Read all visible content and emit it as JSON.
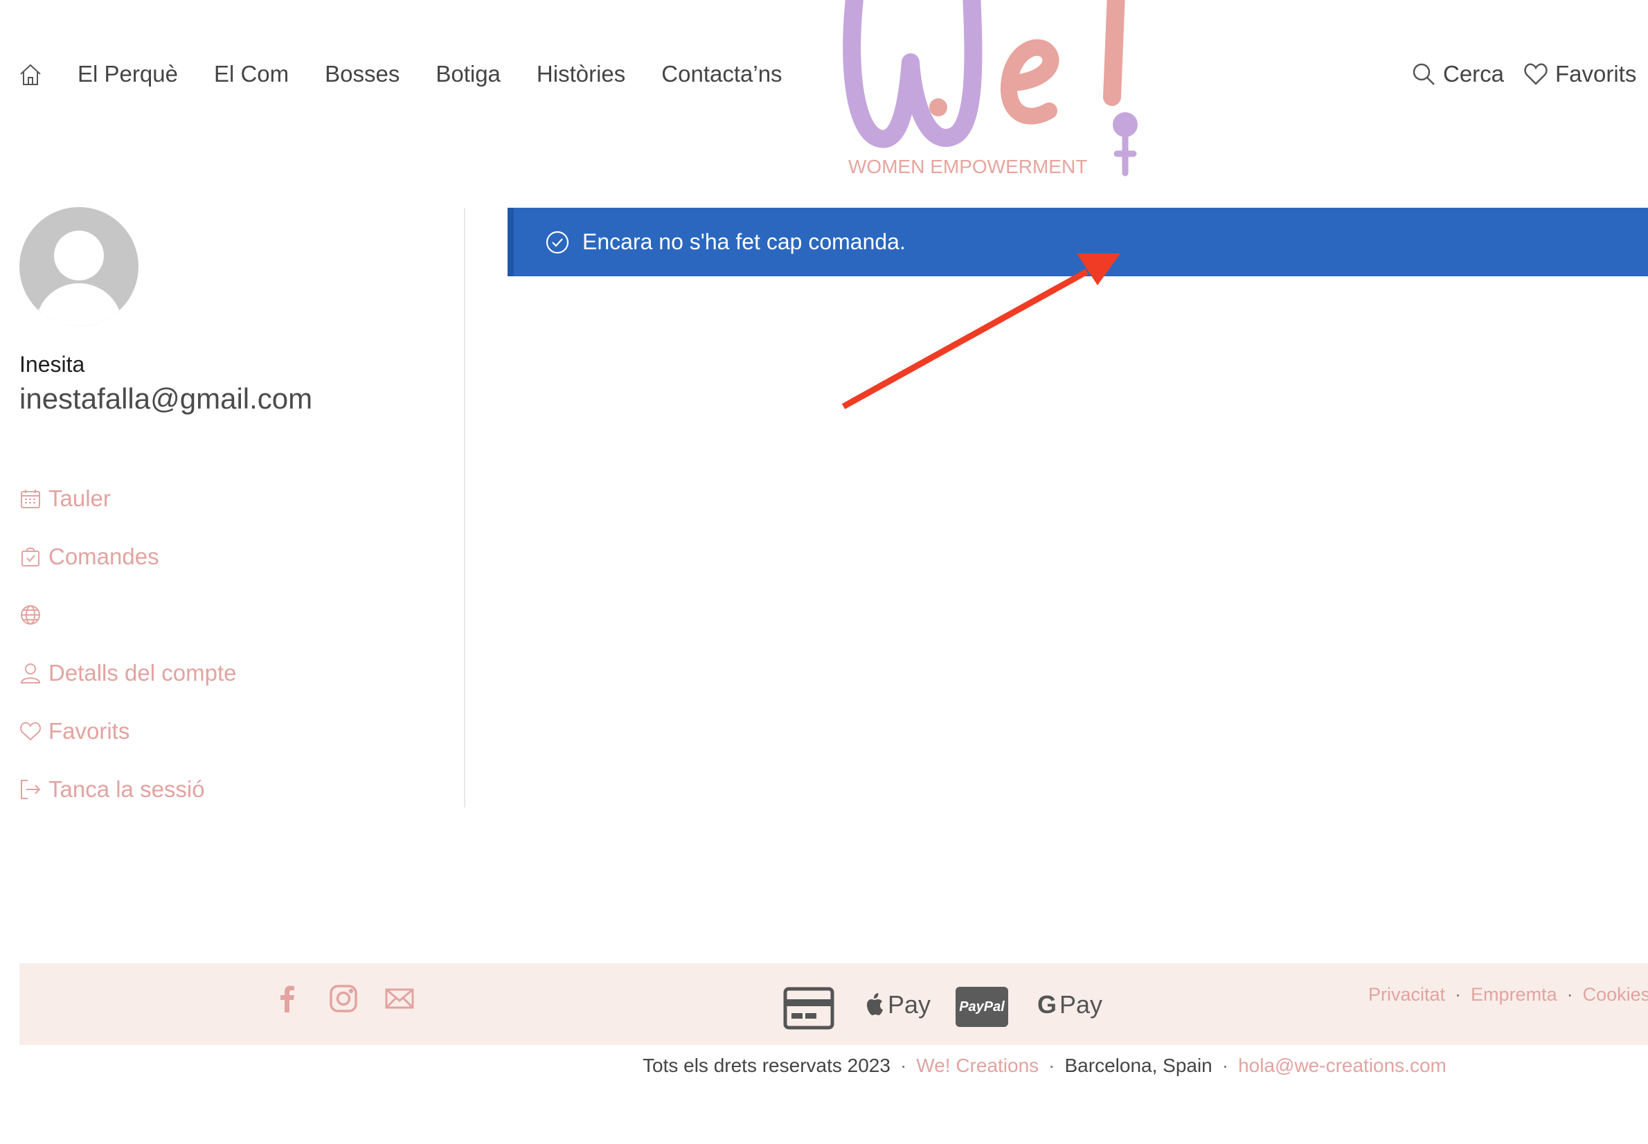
{
  "header": {
    "nav": [
      "El Perquè",
      "El Com",
      "Bosses",
      "Botiga",
      "Històries",
      "Contacta’ns"
    ],
    "logo_tagline": "WOMEN EMPOWERMENT",
    "search_label": "Cerca",
    "favorites_label": "Favorits"
  },
  "user": {
    "name": "Inesita",
    "email": "inestafalla@gmail.com"
  },
  "sidebar": {
    "items": [
      {
        "label": "Tauler",
        "icon": "calendar-icon"
      },
      {
        "label": "Comandes",
        "icon": "bag-check-icon"
      },
      {
        "label": "",
        "icon": "globe-icon"
      },
      {
        "label": "Detalls del compte",
        "icon": "user-icon"
      },
      {
        "label": "Favorits",
        "icon": "heart-icon"
      },
      {
        "label": "Tanca la sessió",
        "icon": "logout-icon"
      }
    ]
  },
  "notice": {
    "text": "Encara no s'ha fet cap comanda."
  },
  "footer": {
    "payments": {
      "apple": "Pay",
      "paypal": "PayPal",
      "google": "Pay"
    },
    "legal": [
      "Privacitat",
      "Empremta",
      "Cookies"
    ],
    "copyright": "Tots els drets reservats 2023",
    "brand": "We! Creations",
    "location": "Barcelona, Spain",
    "email": "hola@we-creations.com"
  },
  "colors": {
    "accent_pink": "#e3a3a0",
    "notice_blue": "#2b67bf",
    "logo_purple": "#c4a6dc",
    "logo_pink": "#e8a49e",
    "annotation_red": "#f03c24"
  }
}
